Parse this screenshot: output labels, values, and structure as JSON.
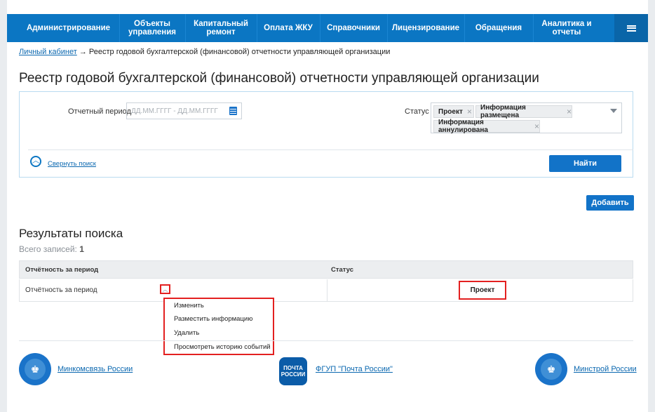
{
  "nav": {
    "items": [
      {
        "label": "Администрирование"
      },
      {
        "label": "Объекты управления"
      },
      {
        "label": "Капитальный ремонт"
      },
      {
        "label": "Оплата ЖКУ"
      },
      {
        "label": "Справочники"
      },
      {
        "label": "Лицензирование"
      },
      {
        "label": "Обращения"
      },
      {
        "label": "Аналитика и отчеты"
      }
    ],
    "menu_icon": "hamburger-icon"
  },
  "breadcrumb": {
    "home": "Личный кабинет",
    "separator": "→",
    "current": "Реестр годовой бухгалтерской (финансовой) отчетности управляющей организации"
  },
  "page_title": "Реестр годовой бухгалтерской (финансовой) отчетности управляющей организации",
  "search": {
    "period_label": "Отчетный период",
    "period_placeholder": "ДД.ММ.ГГГГ  -  ДД.ММ.ГГГГ",
    "status_label": "Статус",
    "status_tags": [
      "Проект",
      "Информация размещена",
      "Информация аннулирована"
    ],
    "tag_remove": "×",
    "collapse_label": "Свернуть поиск",
    "find_button": "Найти"
  },
  "add_button": "Добавить",
  "results": {
    "title": "Результаты поиска",
    "total_label": "Всего записей:",
    "total_count": "1",
    "columns": [
      "Отчётность за период",
      "Статус"
    ],
    "rows": [
      {
        "period": "Отчётность за период",
        "status": "Проект"
      }
    ],
    "action_menu": [
      "Изменить",
      "Разместить информацию",
      "Удалить",
      "Просмотреть историю событий"
    ]
  },
  "footer": {
    "links": [
      "Минкомсвязь России",
      "ФГУП \"Почта России\"",
      "Минстрой России"
    ],
    "post_logo_text": "ПОЧТА РОССИИ"
  },
  "colors": {
    "nav_bg": "#0b76c3",
    "button_bg": "#1273c8",
    "highlight_red": "#e32020"
  }
}
